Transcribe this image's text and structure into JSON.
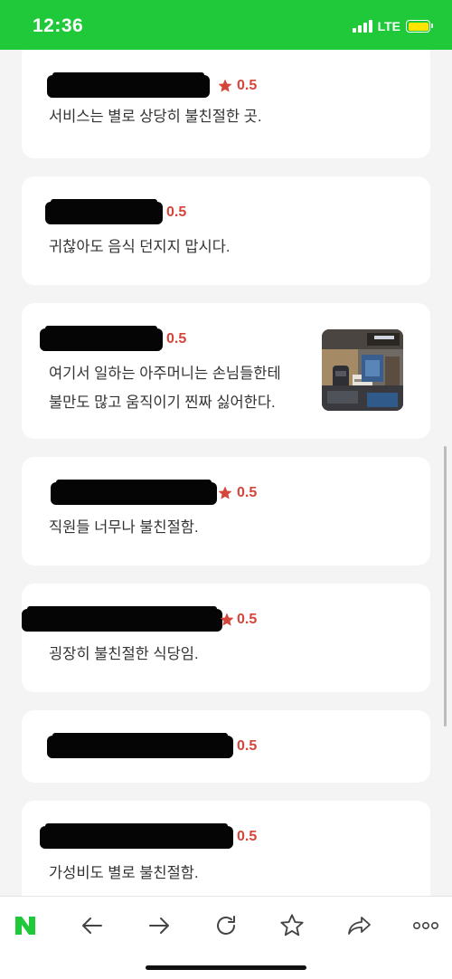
{
  "status_bar": {
    "time": "12:36",
    "network": "LTE",
    "signal_bars": 4,
    "battery_color": "#ffe500"
  },
  "theme": {
    "brand_green": "#1fc93a",
    "score_red": "#d6453a",
    "star_red": "#d6453a"
  },
  "reviews": [
    {
      "score": "0.5",
      "text": "서비스는 별로 상당히 불친절한 곳."
    },
    {
      "score": "0.5",
      "text": "귀찮아도 음식 던지지 맙시다."
    },
    {
      "score": "0.5",
      "text": "여기서 일하는 아주머니는 손님들한테",
      "text_line2": "불만도 많고 움직이기 찐짜 싫어한다."
    },
    {
      "score": "0.5",
      "text": "직원들 너무나 불친절함."
    },
    {
      "score": "0.5",
      "text": "굉장히 불친절한 식당임."
    },
    {
      "score": "0.5",
      "text": ""
    },
    {
      "score": "0.5",
      "text": "가성비도 별로 불친절함."
    }
  ],
  "bottom_nav": [
    {
      "name": "naver-home",
      "icon": "naver-n-icon"
    },
    {
      "name": "back",
      "icon": "back-arrow-icon"
    },
    {
      "name": "forward",
      "icon": "forward-arrow-icon"
    },
    {
      "name": "reload",
      "icon": "reload-icon"
    },
    {
      "name": "bookmark",
      "icon": "star-outline-icon"
    },
    {
      "name": "share",
      "icon": "share-icon"
    },
    {
      "name": "more",
      "icon": "more-icon"
    }
  ]
}
